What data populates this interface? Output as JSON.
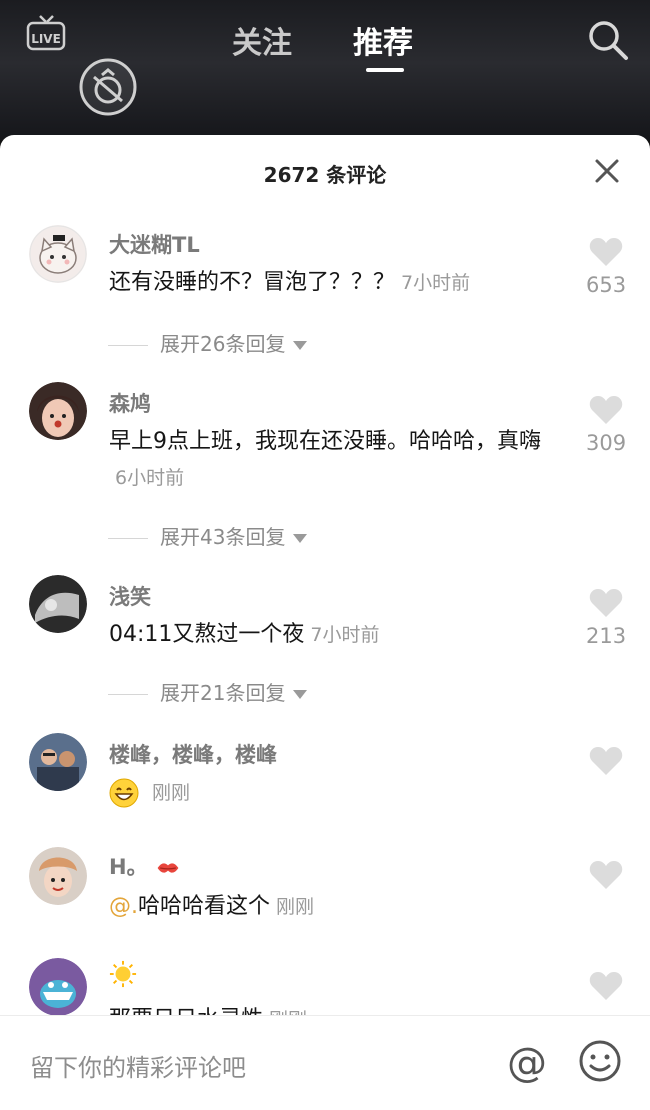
{
  "header": {
    "tabs": [
      {
        "label": "关注",
        "active": false
      },
      {
        "label": "推荐",
        "active": true
      }
    ],
    "live_icon_label": "LIVE",
    "icons": [
      "live-icon",
      "search-icon",
      "circle-action-icon"
    ]
  },
  "comments_sheet": {
    "title": "2672 条评论",
    "comments": [
      {
        "user": "大迷糊TL",
        "text": "还有没睡的不？冒泡了？？？",
        "time": "7小时前",
        "likes": "653",
        "replies": "展开26条回复",
        "avatar": "cat-avatar"
      },
      {
        "user": "森鸠",
        "text": "早上9点上班，我现在还没睡。哈哈哈，真嗨",
        "time": "6小时前",
        "likes": "309",
        "replies": "展开43条回复",
        "avatar": "girl-avatar"
      },
      {
        "user": "浅笑",
        "text": "04:11又熬过一个夜",
        "time": "7小时前",
        "likes": "213",
        "replies": "展开21条回复",
        "avatar": "bw-avatar"
      },
      {
        "user": "楼峰，楼峰，楼峰",
        "text": "",
        "time": "刚刚",
        "likes": "",
        "replies": "",
        "avatar": "group-avatar",
        "emoji": "grin-emoji"
      },
      {
        "user": "H。",
        "mention": "@.",
        "text": "哈哈哈看这个",
        "time": "刚刚",
        "likes": "",
        "replies": "",
        "avatar": "girl2-avatar",
        "name_emoji": "kiss-emoji"
      },
      {
        "user": "",
        "text": "那要日日水灵性",
        "time": "刚刚",
        "likes": "",
        "replies": "",
        "avatar": "monster-avatar",
        "name_emoji": "sun-emoji"
      }
    ]
  },
  "input_bar": {
    "placeholder": "留下你的精彩评论吧",
    "at_symbol": "@"
  },
  "colors": {
    "mention": "#e3a53a",
    "muted": "#9a9a9a",
    "like_heart": "#dcdcdc"
  }
}
